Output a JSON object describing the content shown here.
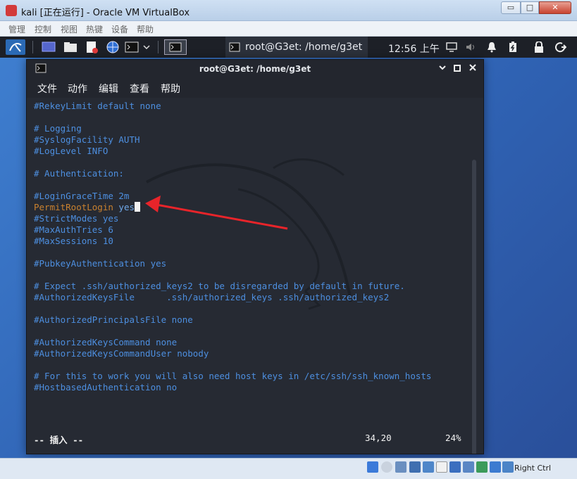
{
  "vbox": {
    "title": "kali [正在运行] - Oracle VM VirtualBox",
    "min_glyph": "▭",
    "max_glyph": "□",
    "close_glyph": "✕",
    "menu": [
      "管理",
      "控制",
      "视图",
      "热键",
      "设备",
      "帮助"
    ],
    "host_key": "Right Ctrl"
  },
  "taskbar": {
    "active_window_title": "root@G3et: /home/g3et",
    "clock": "12:56 上午",
    "icons": [
      "kali-menu-icon",
      "desktop-icon",
      "file-manager-icon",
      "text-editor-icon",
      "browser-icon",
      "terminal-icon",
      "chevron-down-icon",
      "terminal-window-icon"
    ]
  },
  "terminal": {
    "title": "root@G3et: /home/g3et",
    "menu": [
      "文件",
      "动作",
      "编辑",
      "查看",
      "帮助"
    ],
    "lines": [
      {
        "kind": "comment",
        "text": "#RekeyLimit default none"
      },
      {
        "kind": "blank",
        "text": ""
      },
      {
        "kind": "comment",
        "text": "# Logging"
      },
      {
        "kind": "comment",
        "text": "#SyslogFacility AUTH"
      },
      {
        "kind": "comment",
        "text": "#LogLevel INFO"
      },
      {
        "kind": "blank",
        "text": ""
      },
      {
        "kind": "comment",
        "text": "# Authentication:"
      },
      {
        "kind": "blank",
        "text": ""
      },
      {
        "kind": "comment",
        "text": "#LoginGraceTime 2m"
      },
      {
        "kind": "directive",
        "key": "PermitRootLogin",
        "value": "yes"
      },
      {
        "kind": "comment",
        "text": "#StrictModes yes"
      },
      {
        "kind": "comment",
        "text": "#MaxAuthTries 6"
      },
      {
        "kind": "comment",
        "text": "#MaxSessions 10"
      },
      {
        "kind": "blank",
        "text": ""
      },
      {
        "kind": "comment",
        "text": "#PubkeyAuthentication yes"
      },
      {
        "kind": "blank",
        "text": ""
      },
      {
        "kind": "comment",
        "text": "# Expect .ssh/authorized_keys2 to be disregarded by default in future."
      },
      {
        "kind": "comment",
        "text": "#AuthorizedKeysFile      .ssh/authorized_keys .ssh/authorized_keys2"
      },
      {
        "kind": "blank",
        "text": ""
      },
      {
        "kind": "comment",
        "text": "#AuthorizedPrincipalsFile none"
      },
      {
        "kind": "blank",
        "text": ""
      },
      {
        "kind": "comment",
        "text": "#AuthorizedKeysCommand none"
      },
      {
        "kind": "comment",
        "text": "#AuthorizedKeysCommandUser nobody"
      },
      {
        "kind": "blank",
        "text": ""
      },
      {
        "kind": "comment",
        "text": "# For this to work you will also need host keys in /etc/ssh/ssh_known_hosts"
      },
      {
        "kind": "comment",
        "text": "#HostbasedAuthentication no"
      }
    ],
    "status": {
      "mode": "-- 插入 --",
      "position": "34,20",
      "percent": "24%"
    }
  },
  "colors": {
    "comment": "#4d8fe0",
    "directive": "#c9812f",
    "arrow": "#e8242a",
    "terminal_bg": "#262a33"
  }
}
